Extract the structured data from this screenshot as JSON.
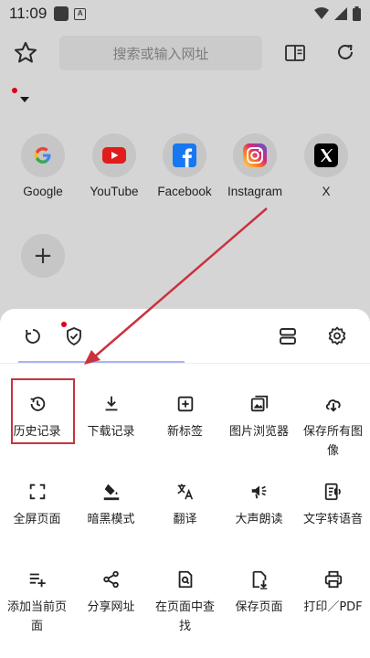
{
  "status": {
    "time": "11:09",
    "notif_badge": "A"
  },
  "toolbar": {
    "search_placeholder": "搜索或输入网址"
  },
  "shortcuts": [
    {
      "label": "Google",
      "icon": "google-icon"
    },
    {
      "label": "YouTube",
      "icon": "youtube-icon"
    },
    {
      "label": "Facebook",
      "icon": "facebook-icon"
    },
    {
      "label": "Instagram",
      "icon": "instagram-icon"
    },
    {
      "label": "X",
      "icon": "x-icon"
    }
  ],
  "menu": {
    "tabs": [
      "undo-icon",
      "shield-check-icon",
      "layout-icon",
      "gear-icon"
    ],
    "items": [
      {
        "label": "历史记录",
        "icon": "history-icon"
      },
      {
        "label": "下载记录",
        "icon": "download-icon"
      },
      {
        "label": "新标签",
        "icon": "new-tab-icon"
      },
      {
        "label": "图片浏览器",
        "icon": "image-browser-icon"
      },
      {
        "label": "保存所有图像",
        "icon": "cloud-download-icon"
      },
      {
        "label": "全屏页面",
        "icon": "fullscreen-icon"
      },
      {
        "label": "暗黑模式",
        "icon": "dark-mode-icon"
      },
      {
        "label": "翻译",
        "icon": "translate-icon"
      },
      {
        "label": "大声朗读",
        "icon": "read-aloud-icon"
      },
      {
        "label": "文字转语音",
        "icon": "text-to-speech-icon"
      },
      {
        "label": "添加当前页面",
        "icon": "add-page-icon"
      },
      {
        "label": "分享网址",
        "icon": "share-icon"
      },
      {
        "label": "在页面中查找",
        "icon": "find-in-page-icon"
      },
      {
        "label": "保存页面",
        "icon": "save-page-icon"
      },
      {
        "label": "打印／PDF",
        "icon": "print-icon"
      }
    ]
  },
  "colors": {
    "accent_dot": "#d9001b",
    "highlight": "#c9323f",
    "tab_underline": "#a9b4f0"
  }
}
